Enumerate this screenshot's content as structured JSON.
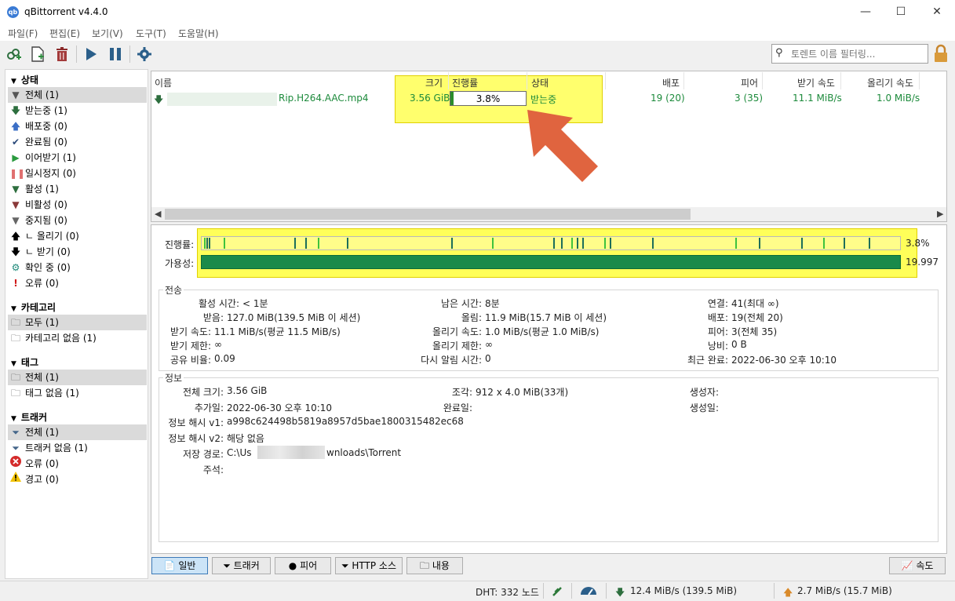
{
  "window": {
    "title": "qBittorrent v4.4.0",
    "app_icon_text": "qb"
  },
  "menu": [
    "파일(F)",
    "편집(E)",
    "보기(V)",
    "도구(T)",
    "도움말(H)"
  ],
  "search": {
    "placeholder": "토렌트 이름 필터링..."
  },
  "sidebar": {
    "status_header": "상태",
    "status_items": [
      {
        "label": "전체 (1)"
      },
      {
        "label": "받는중 (1)"
      },
      {
        "label": "배포중 (0)"
      },
      {
        "label": "완료됨 (0)"
      },
      {
        "label": "이어받기 (1)"
      },
      {
        "label": "일시정지 (0)"
      },
      {
        "label": "활성 (1)"
      },
      {
        "label": "비활성 (0)"
      },
      {
        "label": "중지됨 (0)"
      },
      {
        "label": "ㄴ 올리기 (0)"
      },
      {
        "label": "ㄴ 받기 (0)"
      },
      {
        "label": "확인 중 (0)"
      },
      {
        "label": "오류 (0)"
      }
    ],
    "category_header": "카테고리",
    "category_items": [
      {
        "label": "모두 (1)"
      },
      {
        "label": "카테고리 없음 (1)"
      }
    ],
    "tag_header": "태그",
    "tag_items": [
      {
        "label": "전체 (1)"
      },
      {
        "label": "태그 없음 (1)"
      }
    ],
    "tracker_header": "트래커",
    "tracker_items": [
      {
        "label": "전체 (1)"
      },
      {
        "label": "트래커 없음 (1)"
      },
      {
        "label": "오류 (0)"
      },
      {
        "label": "경고 (0)"
      }
    ]
  },
  "list": {
    "columns": {
      "name": "이름",
      "size": "크기",
      "progress": "진행률",
      "status": "상태",
      "seeds": "배포",
      "peers": "피어",
      "down_speed": "받기 속도",
      "up_speed": "올리기 속도"
    },
    "row": {
      "name": "Rip.H264.AAC.mp4",
      "size": "3.56 GiB",
      "progress_text": "3.8%",
      "progress": 0.038,
      "status": "받는중",
      "seeds": "19 (20)",
      "peers": "3 (35)",
      "down_speed": "11.1 MiB/s",
      "up_speed": "1.0 MiB/s"
    }
  },
  "details": {
    "progress_label": "진행률:",
    "progress_value": "3.8%",
    "availability_label": "가용성:",
    "availability_value": "19.997",
    "transfer": {
      "title": "전송",
      "active_time": {
        "k": "활성 시간:",
        "v": "< 1분"
      },
      "remaining": {
        "k": "남은 시간:",
        "v": "8분"
      },
      "connections": {
        "k": "연결:",
        "v": "41(최대 ∞)"
      },
      "downloaded": {
        "k": "받음:",
        "v": "127.0 MiB(139.5 MiB 이 세션)"
      },
      "uploaded": {
        "k": "올림:",
        "v": "11.9 MiB(15.7 MiB 이 세션)"
      },
      "seeds": {
        "k": "배포:",
        "v": "19(전체 20)"
      },
      "dl_speed": {
        "k": "받기 속도:",
        "v": "11.1 MiB/s(평균 11.5 MiB/s)"
      },
      "ul_speed": {
        "k": "올리기 속도:",
        "v": "1.0 MiB/s(평균 1.0 MiB/s)"
      },
      "peers": {
        "k": "피어:",
        "v": "3(전체 35)"
      },
      "dl_limit": {
        "k": "받기 제한:",
        "v": "∞"
      },
      "ul_limit": {
        "k": "올리기 제한:",
        "v": "∞"
      },
      "wasted": {
        "k": "낭비:",
        "v": "0 B"
      },
      "share_ratio": {
        "k": "공유 비율:",
        "v": "0.09"
      },
      "reannounce": {
        "k": "다시 알림 시간:",
        "v": "0"
      },
      "last_complete": {
        "k": "최근 완료:",
        "v": "2022-06-30 오후 10:10"
      }
    },
    "info": {
      "title": "정보",
      "total_size": {
        "k": "전체 크기:",
        "v": "3.56 GiB"
      },
      "pieces": {
        "k": "조각:",
        "v": "912 x 4.0 MiB(33개)"
      },
      "created_by": {
        "k": "생성자:",
        "v": ""
      },
      "added_on": {
        "k": "추가일:",
        "v": "2022-06-30 오후 10:10"
      },
      "completed_on": {
        "k": "완료일:",
        "v": ""
      },
      "created_on": {
        "k": "생성일:",
        "v": ""
      },
      "hash_v1": {
        "k": "정보 해시 v1:",
        "v": "a998c624498b5819a8957d5bae1800315482ec68"
      },
      "hash_v2": {
        "k": "정보 해시 v2:",
        "v": "해당 없음"
      },
      "save_path": {
        "k": "저장 경로:",
        "v_start": "C:\\Us",
        "v_end": "wnloads\\Torrent"
      },
      "comment": {
        "k": "주석:",
        "v": ""
      }
    }
  },
  "tabs": [
    "일반",
    "트래커",
    "피어",
    "HTTP 소스",
    "내용"
  ],
  "speed_button": "속도",
  "statusbar": {
    "dht": "DHT: 332 노드",
    "down": "12.4 MiB/s (139.5 MiB)",
    "up": "2.7 MiB/s (15.7 MiB)"
  },
  "colors": {
    "accent_green": "#1c8a3b",
    "highlight": "#ffff3c",
    "arrow": "#e0643f"
  }
}
